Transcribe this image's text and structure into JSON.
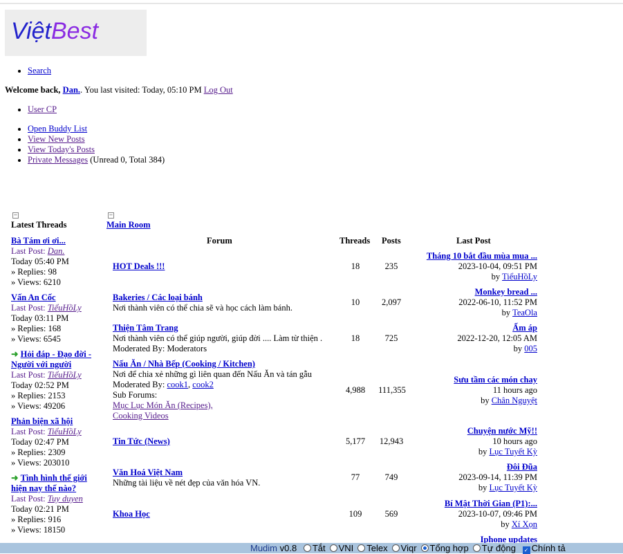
{
  "logo": {
    "part1": "Việt",
    "part2": "Best"
  },
  "nav": {
    "search": "Search"
  },
  "welcome": {
    "prefix": "Welcome back, ",
    "user": "Dan.",
    "mid": ". You last visited: Today, 05:10 PM ",
    "logout": "Log Out"
  },
  "usercp": "User CP",
  "links": {
    "buddy": "Open Buddy List",
    "new_posts": "View New Posts",
    "today_posts": "View Today's Posts",
    "pm": "Private Messages",
    "pm_counts": " (Unread 0, Total 384)"
  },
  "sidebar": {
    "title": "Latest Threads",
    "last_post_label": "Last Post:",
    "threads": [
      {
        "title": "Bà Tám ơi ơi...",
        "arrow": false,
        "poster": "Dan.",
        "time": "Today 05:40 PM",
        "replies": "» Replies: 98",
        "views": "» Views: 6210"
      },
      {
        "title": "Vấn An Cốc",
        "arrow": false,
        "poster": "TiểuHồLy",
        "time": "Today 03:11 PM",
        "replies": "» Replies: 168",
        "views": "» Views: 6545"
      },
      {
        "title": "Hỏi đáp - Đạo đời - Người với người",
        "arrow": true,
        "poster": "TiểuHồLy",
        "time": "Today 02:52 PM",
        "replies": "» Replies: 2153",
        "views": "» Views: 49206"
      },
      {
        "title": "Phản biện xã hội",
        "arrow": false,
        "poster": "TiểuHồLy",
        "time": "Today 02:47 PM",
        "replies": "» Replies: 2309",
        "views": "» Views: 203010"
      },
      {
        "title": "Tình hình thế giới hiện nay thế nào?",
        "arrow": true,
        "poster": "Tuy duyen",
        "time": "Today 02:21 PM",
        "replies": "» Replies: 916",
        "views": "» Views: 18150"
      }
    ]
  },
  "main": {
    "title": "Main Room",
    "headers": {
      "forum": "Forum",
      "threads": "Threads",
      "posts": "Posts",
      "last_post": "Last Post"
    },
    "forums": [
      {
        "name": "HOT Deals !!!",
        "desc": "",
        "threads": "18",
        "posts": "235",
        "lp_title": "Tháng 10 bắt đầu mùa mua ...",
        "lp_time": "2023-10-04, 09:51 PM",
        "by": "by",
        "lp_user": "TiểuHồLy"
      },
      {
        "name": "Bakeries / Các loại bánh",
        "desc": "Nơi thành viên có thể chia sẽ và học cách làm bánh.",
        "threads": "10",
        "posts": "2,097",
        "lp_title": "Monkey bread ...",
        "lp_time": "2022-06-10, 11:52 PM",
        "by": "by",
        "lp_user": "TeaOla"
      },
      {
        "name": "Thiện Tâm Trang",
        "desc": "Nơi thành viên có thể giúp người, giúp đời .... Làm từ thiện .",
        "moderated": "Moderated By: Moderators",
        "threads": "18",
        "posts": "725",
        "lp_title": "Ấm áp",
        "lp_time": "2022-12-20, 12:05 AM",
        "by": "by",
        "lp_user": "005"
      },
      {
        "name": "Nấu Ăn / Nhà Bếp (Cooking / Kitchen)",
        "desc": "Nơi để chia xẻ những gì liên quan đến Nấu Ăn và tán gẫu",
        "moderated_label": "Moderated By: ",
        "mod1": "cook1",
        "mod2": "cook2",
        "sub_label": "Sub Forums:",
        "sub1": "Mục Lục Món Ăn (Recipes),",
        "sub2": "Cooking Videos",
        "threads": "4,988",
        "posts": "111,355",
        "lp_title": "Sưu tầm các món chay",
        "lp_time": "11 hours ago",
        "by": "by",
        "lp_user": "Chân Nguyệt"
      },
      {
        "name": "Tin Tức (News)",
        "desc": "",
        "threads": "5,177",
        "posts": "12,943",
        "lp_title": "Chuyện nước Mỹ!!",
        "lp_time": "10 hours ago",
        "by": "by",
        "lp_user": "Lục Tuyết Kỳ"
      },
      {
        "name": "Văn Hoá Việt Nam",
        "desc": "Những tài liệu về nét đẹp của văn hóa VN.",
        "threads": "77",
        "posts": "749",
        "lp_title": "Đôi Đũa",
        "lp_time": "2023-09-14, 11:39 PM",
        "by": "by",
        "lp_user": "Lục Tuyết Kỳ"
      },
      {
        "name": "Khoa Học",
        "desc": "",
        "threads": "109",
        "posts": "569",
        "lp_title": "Bí Mật Thời Gian (P1):...",
        "lp_time": "2023-10-07, 09:46 PM",
        "by": "by",
        "lp_user": "Xí Xọn"
      },
      {
        "lp_title": "Iphone updates"
      }
    ]
  },
  "mudim": {
    "name": "Mudim",
    "version": " v0.8",
    "options": [
      "Tắt",
      "VNI",
      "Telex",
      "Viqr",
      "Tổng hợp",
      "Tự động"
    ],
    "selected": "Tổng hợp",
    "spell": "Chính tả"
  }
}
